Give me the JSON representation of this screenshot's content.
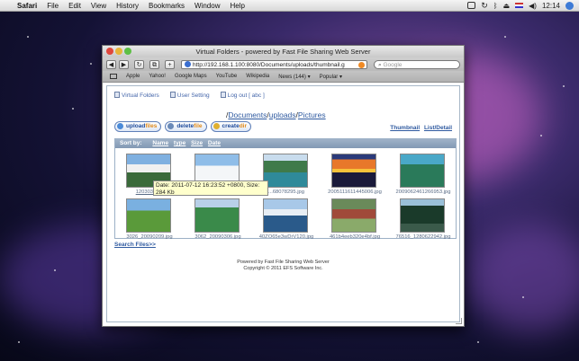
{
  "menubar": {
    "app_name": "Safari",
    "menus": [
      "File",
      "Edit",
      "View",
      "History",
      "Bookmarks",
      "Window",
      "Help"
    ],
    "clock": "12:14"
  },
  "window": {
    "title": "Virtual Folders - powered by Fast File Sharing Web Server",
    "url": "http://192.168.1.100:8080/Documents/uploads/thumbnail.g",
    "search_placeholder": "Google"
  },
  "bookmarks": [
    "Apple",
    "Yahoo!",
    "Google Maps",
    "YouTube",
    "Wikipedia",
    "News (144)",
    "Popular"
  ],
  "page": {
    "nav": {
      "virtual_folders": "Virtual Folders",
      "user_setting": "User Setting",
      "logout": "Log out [ abc ]"
    },
    "path": {
      "sep": "/",
      "documents": "Documents",
      "uploads": "uploads",
      "pictures": "Pictures"
    },
    "actions": {
      "upload_a": "upload",
      "upload_b": "files",
      "delete_a": "delete",
      "delete_b": "file",
      "create_a": "create",
      "create_b": "dir"
    },
    "view_links": {
      "thumbnail": "Thumbnail",
      "list_detail": "List/Detail"
    },
    "sort": {
      "label": "Sort by:",
      "name": "Name",
      "type": "type",
      "size": "Size",
      "date": "Date"
    },
    "files": [
      "12030328...",
      "",
      "...68078295.jpg",
      "2005111611445006.jpg",
      "2009062461266953.jpg",
      "3026_20090209.jpg",
      "3062_20090306.jpg",
      "40ZO65e3wDrV120.jpg",
      "461b4eeb320e4bf.jpg",
      "76516_1280622942.jpg"
    ],
    "tooltip": "Date: 2011-07-12 16:23:52 +0800, Size: 284 Kb",
    "search_files": "Search Files>>",
    "footer": {
      "line1": "Powered by Fast File Sharing Web Server",
      "line2": "Copyright © 2011 EFS Software Inc."
    }
  },
  "colors": {
    "link": "#2f5aa0",
    "sort_bar": "#8299b4",
    "tooltip_bg": "#ffffcc"
  }
}
